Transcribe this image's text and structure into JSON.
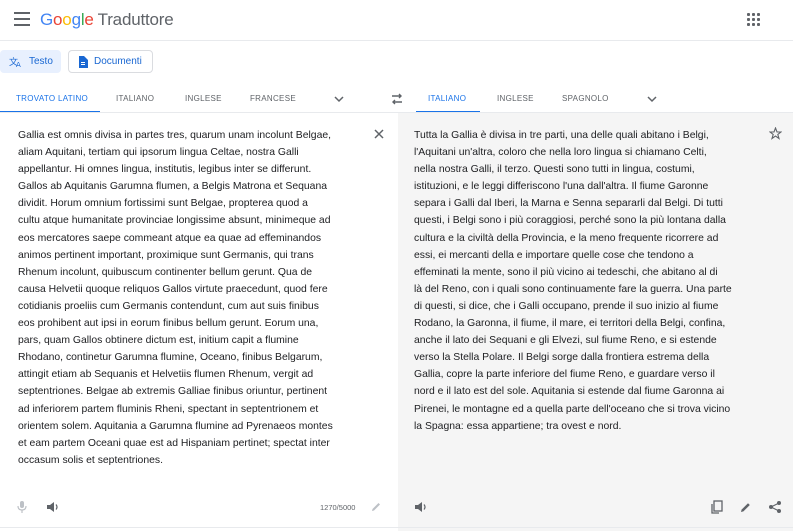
{
  "header": {
    "logo_letters": [
      "G",
      "o",
      "o",
      "g",
      "l",
      "e"
    ],
    "logo_colors": [
      "#4285f4",
      "#ea4335",
      "#fbbc05",
      "#4285f4",
      "#34a853",
      "#ea4335"
    ],
    "product_name": "Traduttore",
    "menu_icon": "hamburger-menu-icon",
    "apps_icon": "apps-grid-icon"
  },
  "modes": {
    "text_label": "Testo",
    "text_icon": "translate-icon",
    "documents_label": "Documenti",
    "documents_icon": "document-icon"
  },
  "source_languages": {
    "tabs": [
      {
        "label": "TROVATO LATINO",
        "active": true
      },
      {
        "label": "ITALIANO",
        "active": false
      },
      {
        "label": "INGLESE",
        "active": false
      },
      {
        "label": "FRANCESE",
        "active": false
      }
    ],
    "more_icon": "chevron-down-icon"
  },
  "swap_icon": "swap-languages-icon",
  "target_languages": {
    "tabs": [
      {
        "label": "ITALIANO",
        "active": true
      },
      {
        "label": "INGLESE",
        "active": false
      },
      {
        "label": "SPAGNOLO",
        "active": false
      }
    ],
    "more_icon": "chevron-down-icon"
  },
  "source": {
    "lines": [
      "Gallia est omnis divisa in partes tres, quarum unam incolunt Belgae,",
      "aliam Aquitani, tertiam qui ipsorum lingua Celtae, nostra Galli",
      "appellantur. Hi omnes lingua, institutis, legibus inter se differunt.",
      "Gallos ab Aquitanis Garumna flumen, a Belgis Matrona et Sequana",
      "dividit. Horum omnium fortissimi sunt Belgae, propterea quod a",
      "cultu atque humanitate provinciae longissime absunt, minimeque ad",
      "eos mercatores saepe commeant atque ea quae ad effeminandos",
      "animos pertinent important, proximique sunt Germanis, qui trans",
      "Rhenum incolunt, quibuscum continenter bellum gerunt. Qua de",
      "causa Helvetii quoque reliquos Gallos virtute praecedunt, quod fere",
      "cotidianis proeliis cum Germanis contendunt, cum aut suis finibus",
      "eos prohibent aut ipsi in eorum finibus bellum gerunt. Eorum una,",
      "pars, quam Gallos obtinere dictum est, initium capit a flumine",
      "Rhodano, continetur Garumna flumine, Oceano, finibus Belgarum,",
      "attingit etiam ab Sequanis et Helvetiis flumen Rhenum, vergit ad",
      "septentriones. Belgae ab extremis Galliae finibus oriuntur, pertinent",
      "ad inferiorem partem fluminis Rheni, spectant in septentrionem et",
      "orientem solem. Aquitania a Garumna flumine ad Pyrenaeos montes",
      "et eam partem Oceani quae est ad Hispaniam pertinet; spectat inter",
      "occasum solis et septentriones."
    ],
    "char_count": "1270/5000",
    "clear_icon": "close-icon",
    "mic_icon": "microphone-icon",
    "listen_icon": "speaker-icon",
    "edit_icon": "pencil-icon"
  },
  "target": {
    "lines": [
      "Tutta la Gallia è divisa in tre parti, una delle quali abitano i Belgi,",
      "l'Aquitani un'altra, coloro che nella loro lingua si chiamano Celti,",
      "nella nostra Galli, il terzo. Questi sono tutti in lingua, costumi,",
      "istituzioni, e le leggi differiscono l'una dall'altra. Il fiume Garonne",
      "separa i Galli dal Iberi, la Marna e Senna separarli dal Belgi. Di tutti",
      "questi, i Belgi sono i più coraggiosi, perché sono la più lontana dalla",
      "cultura e la civiltà della Provincia, e la meno frequente ricorrere ad",
      "essi, ei mercanti della e importare quelle cose che tendono a",
      "effeminati la mente, sono il più vicino ai tedeschi, che abitano al di",
      "là del Reno, con i quali sono continuamente fare la guerra. Una parte",
      "di questi, si dice, che i Galli occupano, prende il suo inizio al fiume",
      "Rodano, la Garonna, il fiume, il mare, ei territori della Belgi, confina,",
      "anche il lato dei Sequani e gli Elvezi, sul fiume Reno, e si estende",
      "verso la Stella Polare. Il Belgi sorge dalla frontiera estrema della",
      "Gallia, copre la parte inferiore del fiume Reno, e guardare verso il",
      "nord e il lato est del sole. Aquitania si estende dal fiume Garonna ai",
      "Pirenei, le montagne ed a quella parte dell'oceano che si trova vicino",
      "la Spagna: essa appartiene; tra ovest e nord."
    ],
    "star_icon": "star-icon",
    "listen_icon": "speaker-icon",
    "copy_icon": "copy-icon",
    "edit_icon": "pencil-icon",
    "share_icon": "share-icon"
  },
  "colors": {
    "accent": "#1a73e8",
    "mode_active_bg": "#e8f0fe",
    "target_panel_bg": "#f5f5f5"
  }
}
